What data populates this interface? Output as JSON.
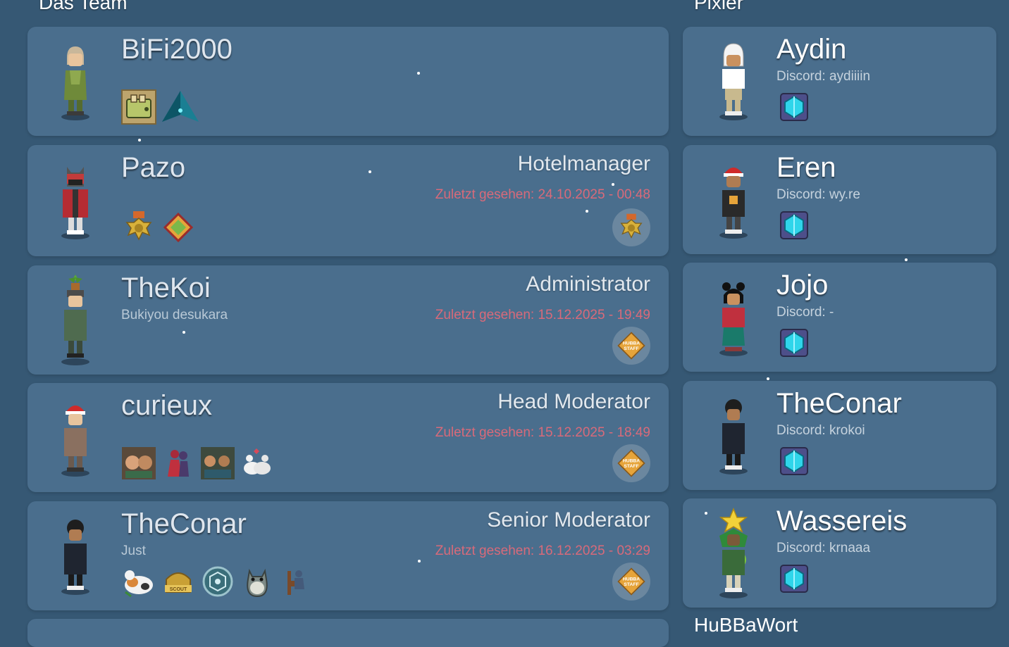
{
  "team": {
    "title": "Das Team",
    "members": [
      {
        "name": "BiFi2000",
        "motto": "",
        "role": "",
        "last_seen": ""
      },
      {
        "name": "Pazo",
        "motto": "",
        "role": "Hotelmanager",
        "last_seen": "Zuletzt gesehen: 24.10.2025 - 00:48"
      },
      {
        "name": "TheKoi",
        "motto": "Bukiyou desukara",
        "role": "Administrator",
        "last_seen": "Zuletzt gesehen: 15.12.2025 - 19:49"
      },
      {
        "name": "curieux",
        "motto": "",
        "role": "Head Moderator",
        "last_seen": "Zuletzt gesehen: 15.12.2025 - 18:49"
      },
      {
        "name": "TheConar",
        "motto": "Just",
        "role": "Senior Moderator",
        "last_seen": "Zuletzt gesehen: 16.12.2025 - 03:29"
      }
    ]
  },
  "pixler": {
    "title": "Pixler",
    "members": [
      {
        "name": "Aydin",
        "discord": "Discord: aydiiiin"
      },
      {
        "name": "Eren",
        "discord": "Discord: wy.re"
      },
      {
        "name": "Jojo",
        "discord": "Discord: -"
      },
      {
        "name": "TheConar",
        "discord": "Discord: krokoi"
      },
      {
        "name": "Wassereis",
        "discord": "Discord: krnaaa"
      }
    ]
  },
  "next_section": {
    "title": "HuBBaWort"
  },
  "staff_badge_text": "HUBBA STAFF",
  "colors": {
    "background": "#365874",
    "card": "#4a6e8d",
    "last_seen": "#d86a7a",
    "gem": "#2fd5ea"
  }
}
